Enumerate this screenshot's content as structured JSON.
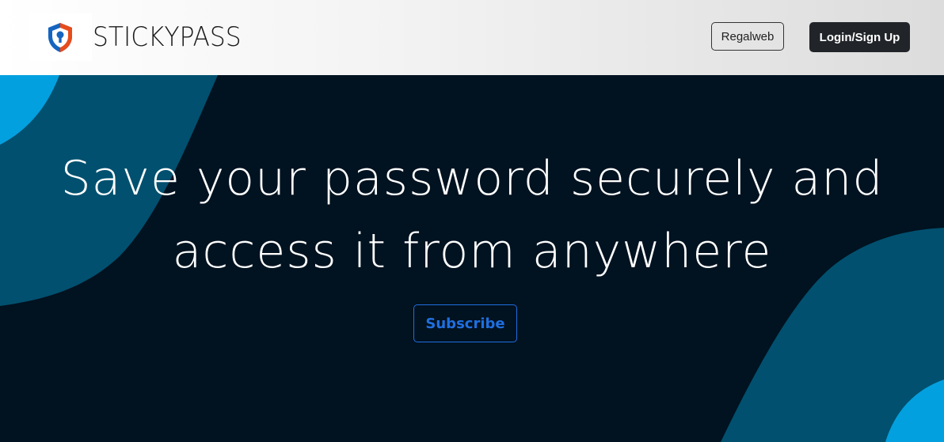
{
  "header": {
    "brand": "STICKYPASS",
    "logo_icon": "shield-keyhole-icon",
    "nav_button_label": "Regalweb",
    "login_button_label": "Login/Sign Up"
  },
  "hero": {
    "headline_line1": "Save your password securely and",
    "headline_line2": "access it from anywhere",
    "subscribe_label": "Subscribe"
  },
  "colors": {
    "hero_background": "#011220",
    "wave_dark": "#01506f",
    "wave_light": "#03a0df",
    "subscribe_accent": "#1f6fe0",
    "login_button": "#212529",
    "logo_blue": "#1565c0",
    "logo_red": "#e74c1c"
  }
}
